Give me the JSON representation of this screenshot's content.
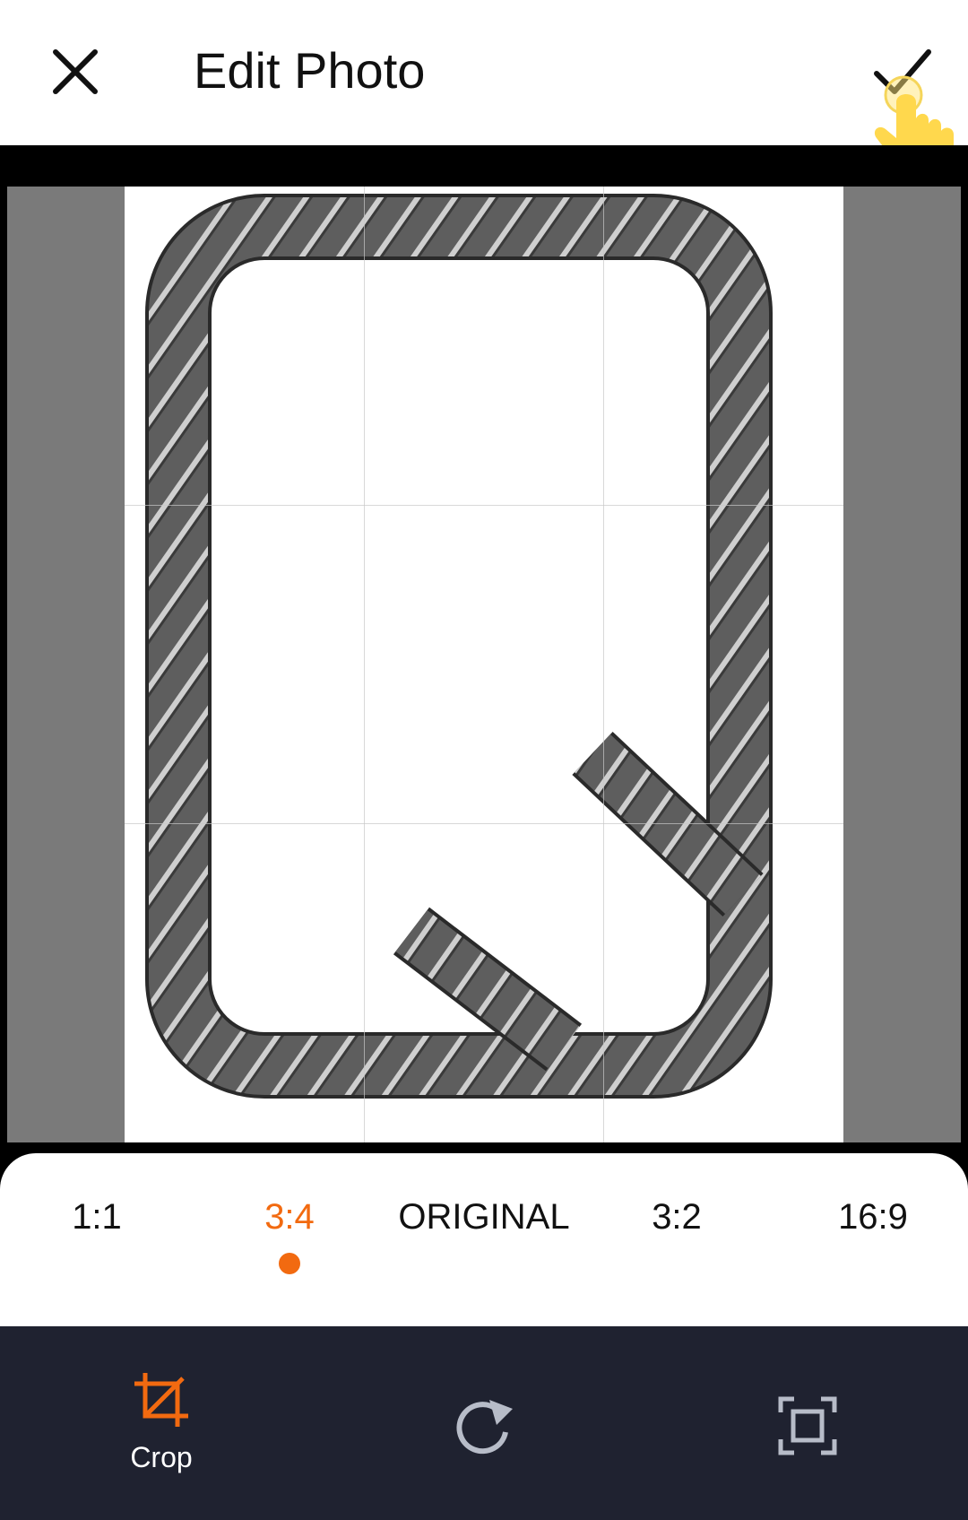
{
  "header": {
    "title": "Edit Photo",
    "close_icon": "close-icon",
    "confirm_icon": "checkmark-icon"
  },
  "editor": {
    "image_description_icon": "rebar-stirrup-image"
  },
  "ratios": {
    "items": [
      {
        "label": "1:1"
      },
      {
        "label": "3:4"
      },
      {
        "label": "ORIGINAL"
      },
      {
        "label": "3:2"
      },
      {
        "label": "16:9"
      }
    ],
    "selected_index": 1
  },
  "toolbar": {
    "crop_label": "Crop",
    "crop_icon": "crop-icon",
    "rotate_icon": "rotate-icon",
    "fit_icon": "fit-frame-icon"
  },
  "colors": {
    "accent": "#f26a10",
    "toolbar_bg": "#1f2230",
    "stage_bg": "#7a7a7a"
  }
}
